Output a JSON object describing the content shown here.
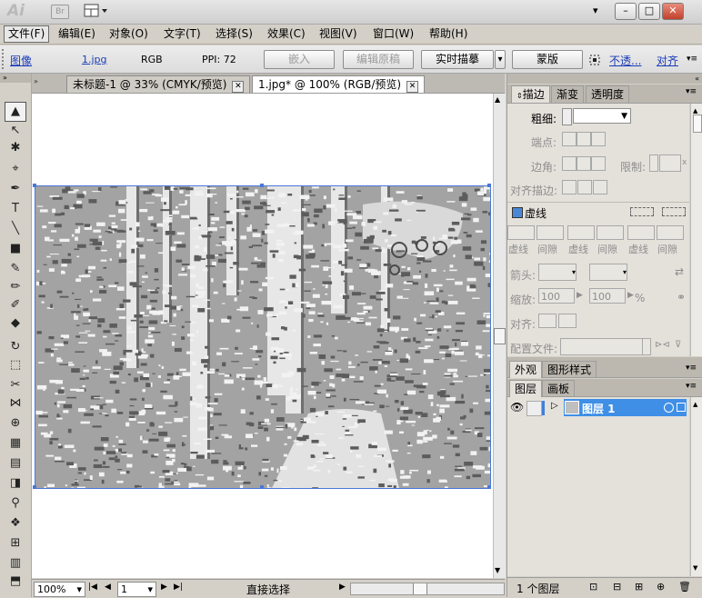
{
  "app": {
    "logo": "Ai",
    "bridge_label": "Br",
    "window_controls": [
      "▾",
      "–",
      "□",
      "✕"
    ]
  },
  "menu": [
    "文件(F)",
    "编辑(E)",
    "对象(O)",
    "文字(T)",
    "选择(S)",
    "效果(C)",
    "视图(V)",
    "窗口(W)",
    "帮助(H)"
  ],
  "control_bar": {
    "type_label": "图像",
    "filename": "1.jpg",
    "color_mode": "RGB",
    "ppi": "PPI: 72",
    "embed": "嵌入",
    "edit_original": "编辑原稿",
    "live_trace": "实时描摹",
    "live_trace_arrow": "▾",
    "mask": "蒙版",
    "opacity_link": "不透...",
    "align_link": "对齐"
  },
  "doc_tabs": [
    {
      "label": "未标题-1 @ 33% (CMYK/预览)",
      "close": "✕"
    },
    {
      "label": "1.jpg* @ 100% (RGB/预览)",
      "close": "✕"
    }
  ],
  "tools": [
    "▲",
    "↖",
    "✱",
    "⌖",
    "✒",
    "T",
    "╲",
    "■",
    "✎",
    "✏",
    "✐",
    "◆",
    "↻",
    "⬚",
    "✂",
    "⋈",
    "⊕",
    "▦",
    "▤",
    "◨",
    "⚲",
    "❖",
    "⊞",
    "▥",
    "⬒"
  ],
  "status_bar": {
    "zoom": "100%",
    "zoom_arrow": "▾",
    "nav_first": "|◀",
    "nav_prev": "◀",
    "page": "1",
    "nav_next": "▶",
    "nav_last": "▶|",
    "tool_name": "直接选择",
    "tool_arrow": "▶"
  },
  "stroke_panel": {
    "tabs": [
      "描边",
      "渐变",
      "透明度"
    ],
    "weight_label": "粗细:",
    "cap_label": "端点:",
    "corner_label": "边角:",
    "limit_label": "限制:",
    "limit_unit": "x",
    "align_label": "对齐描边:",
    "dashed_label": "虚线",
    "dash_labels": [
      "虚线",
      "间隙",
      "虚线",
      "间隙",
      "虚线",
      "间隙"
    ],
    "arrowheads_label": "箭头:",
    "scale_label": "缩放:",
    "scale_start": "100",
    "scale_end": "100",
    "percent": "%",
    "align_arrows_label": "对齐:",
    "profile_label": "配置文件:"
  },
  "appearance_panel": {
    "tabs": [
      "外观",
      "图形样式"
    ]
  },
  "layers_panel": {
    "tabs": [
      "图层",
      "画板"
    ],
    "layer_name": "图层 1",
    "footer_count": "1 个图层"
  },
  "colors": {
    "selection": "#4a78d9",
    "layer_highlight": "#3f8fe6",
    "link": "#1a3cb8"
  }
}
